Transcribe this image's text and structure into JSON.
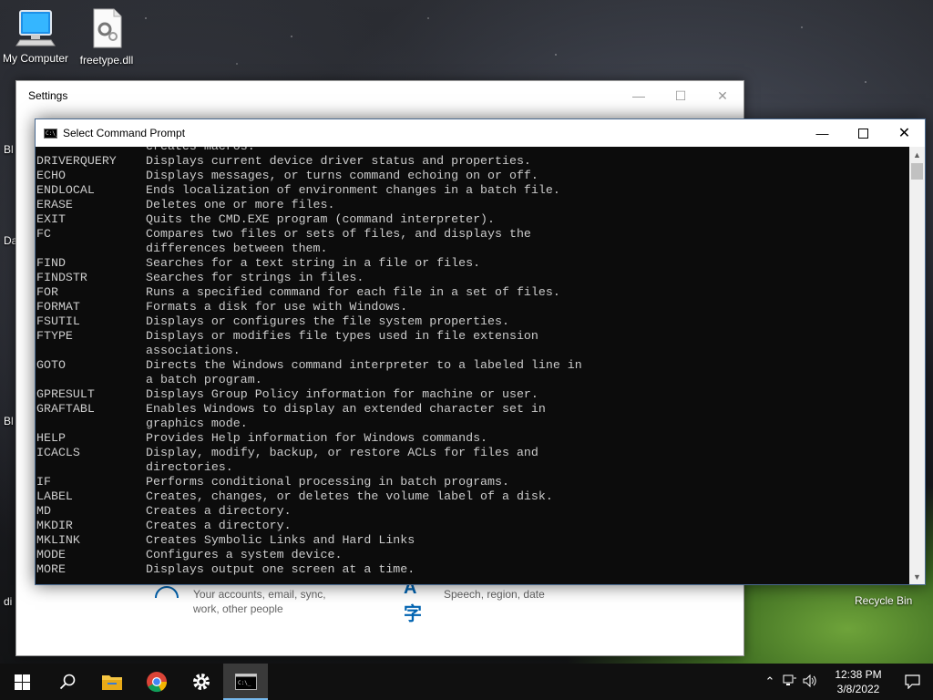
{
  "desktop": {
    "icons": [
      {
        "label": "My Computer",
        "icon": "computer-icon"
      },
      {
        "label": "freetype.dll",
        "icon": "dll-file-icon"
      },
      {
        "label": "Recycle Bin",
        "icon": "recycle-bin-icon"
      }
    ],
    "edge_labels": [
      "Bl",
      "Da",
      "Bl",
      "di"
    ]
  },
  "settings_window": {
    "title": "Settings",
    "controls": [
      "minimize",
      "maximize",
      "close"
    ],
    "items": [
      {
        "icon": "accounts-icon",
        "desc_line1": "Your accounts, email, sync,",
        "desc_line2": "work, other people"
      },
      {
        "icon": "language-icon",
        "desc_line1": "Speech, region, date",
        "desc_line2": ""
      }
    ]
  },
  "cmd_window": {
    "title": "Select Command Prompt",
    "controls": [
      "minimize",
      "maximize",
      "close"
    ],
    "lines": [
      {
        "cmd": "",
        "desc": "creates macros."
      },
      {
        "cmd": "DRIVERQUERY",
        "desc": "Displays current device driver status and properties."
      },
      {
        "cmd": "ECHO",
        "desc": "Displays messages, or turns command echoing on or off."
      },
      {
        "cmd": "ENDLOCAL",
        "desc": "Ends localization of environment changes in a batch file."
      },
      {
        "cmd": "ERASE",
        "desc": "Deletes one or more files."
      },
      {
        "cmd": "EXIT",
        "desc": "Quits the CMD.EXE program (command interpreter)."
      },
      {
        "cmd": "FC",
        "desc": "Compares two files or sets of files, and displays the"
      },
      {
        "cmd": "",
        "desc": "differences between them."
      },
      {
        "cmd": "FIND",
        "desc": "Searches for a text string in a file or files."
      },
      {
        "cmd": "FINDSTR",
        "desc": "Searches for strings in files."
      },
      {
        "cmd": "FOR",
        "desc": "Runs a specified command for each file in a set of files."
      },
      {
        "cmd": "FORMAT",
        "desc": "Formats a disk for use with Windows."
      },
      {
        "cmd": "FSUTIL",
        "desc": "Displays or configures the file system properties."
      },
      {
        "cmd": "FTYPE",
        "desc": "Displays or modifies file types used in file extension"
      },
      {
        "cmd": "",
        "desc": "associations."
      },
      {
        "cmd": "GOTO",
        "desc": "Directs the Windows command interpreter to a labeled line in"
      },
      {
        "cmd": "",
        "desc": "a batch program."
      },
      {
        "cmd": "GPRESULT",
        "desc": "Displays Group Policy information for machine or user."
      },
      {
        "cmd": "GRAFTABL",
        "desc": "Enables Windows to display an extended character set in"
      },
      {
        "cmd": "",
        "desc": "graphics mode."
      },
      {
        "cmd": "HELP",
        "desc": "Provides Help information for Windows commands."
      },
      {
        "cmd": "ICACLS",
        "desc": "Display, modify, backup, or restore ACLs for files and"
      },
      {
        "cmd": "",
        "desc": "directories."
      },
      {
        "cmd": "IF",
        "desc": "Performs conditional processing in batch programs."
      },
      {
        "cmd": "LABEL",
        "desc": "Creates, changes, or deletes the volume label of a disk."
      },
      {
        "cmd": "MD",
        "desc": "Creates a directory."
      },
      {
        "cmd": "MKDIR",
        "desc": "Creates a directory."
      },
      {
        "cmd": "MKLINK",
        "desc": "Creates Symbolic Links and Hard Links"
      },
      {
        "cmd": "MODE",
        "desc": "Configures a system device."
      },
      {
        "cmd": "MORE",
        "desc": "Displays output one screen at a time."
      }
    ]
  },
  "taskbar": {
    "buttons": [
      {
        "name": "start",
        "icon": "windows-logo-icon"
      },
      {
        "name": "search",
        "icon": "search-icon"
      },
      {
        "name": "file-explorer",
        "icon": "folder-icon"
      },
      {
        "name": "chrome",
        "icon": "chrome-icon"
      },
      {
        "name": "settings",
        "icon": "gear-icon"
      },
      {
        "name": "command-prompt",
        "icon": "terminal-icon",
        "active": true
      }
    ],
    "tray": {
      "time": "12:38 PM",
      "date": "3/8/2022"
    }
  },
  "colors": {
    "console_bg": "#0c0c0c",
    "console_text": "#cccccc",
    "taskbar_bg": "#101010",
    "accent": "#76b9ed"
  }
}
